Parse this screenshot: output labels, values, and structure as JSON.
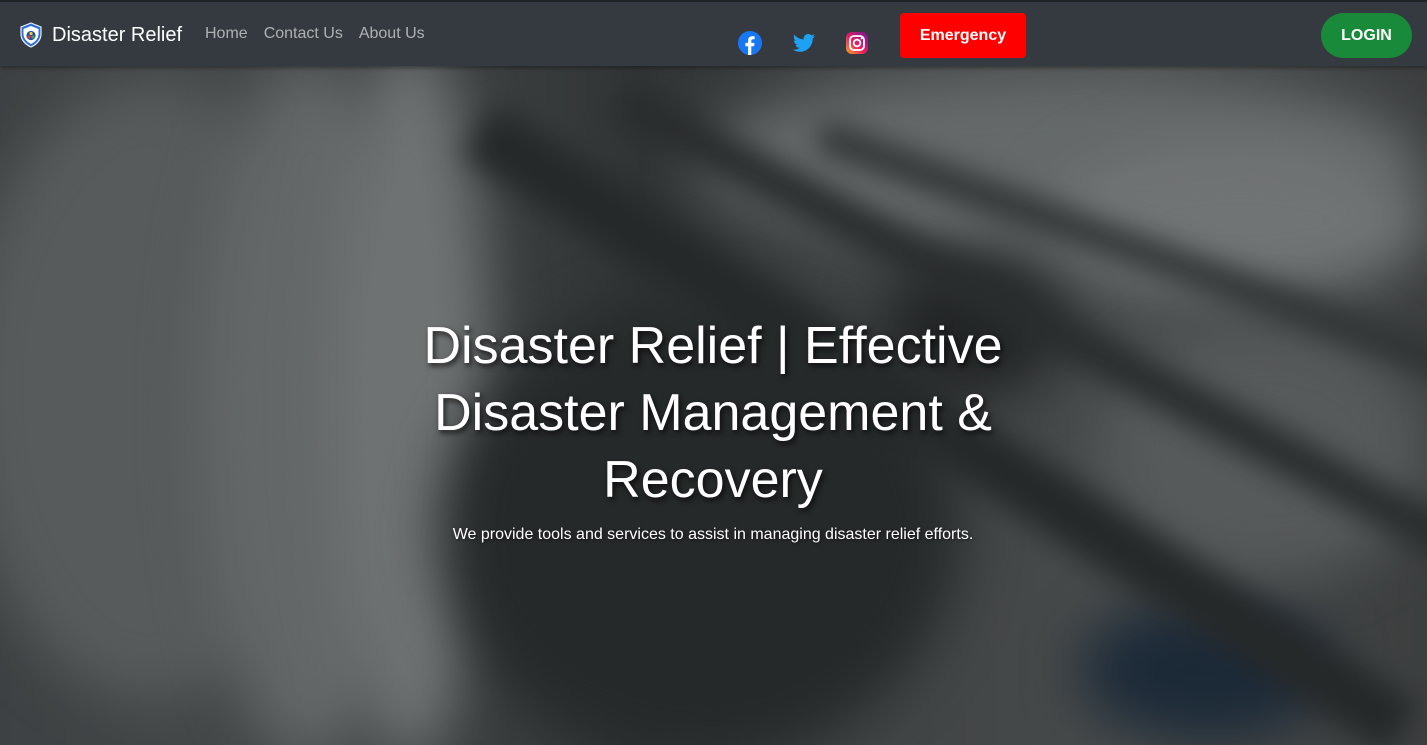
{
  "brand": {
    "name": "Disaster Relief",
    "logo_icon": "shield-logo-icon"
  },
  "nav": {
    "links": [
      {
        "label": "Home"
      },
      {
        "label": "Contact Us"
      },
      {
        "label": "About Us"
      }
    ]
  },
  "social": {
    "icons": [
      "facebook-icon",
      "twitter-icon",
      "instagram-icon"
    ]
  },
  "actions": {
    "emergency_label": "Emergency",
    "login_label": "LOGIN"
  },
  "hero": {
    "title": "Disaster Relief | Effective Disaster Management & Recovery",
    "subtitle": "We provide tools and services to assist in managing disaster relief efforts."
  },
  "colors": {
    "navbar_bg": "#343a40",
    "emergency": "#ff0000",
    "login": "#198a3a",
    "facebook": "#1877f2",
    "twitter": "#1da1f2"
  }
}
